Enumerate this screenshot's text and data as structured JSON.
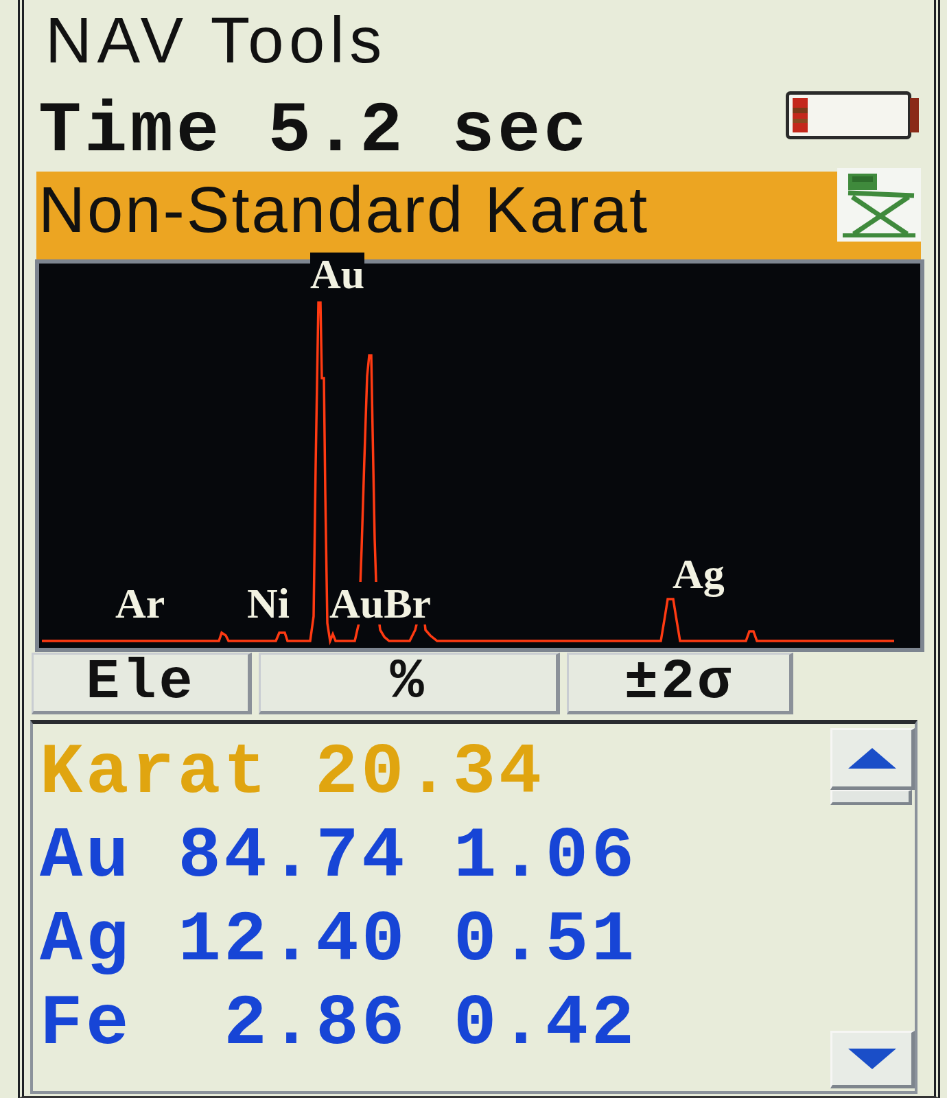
{
  "header": {
    "title": "NAV Tools",
    "time": "Time 5.2 sec"
  },
  "status_bar": {
    "text": "Non-Standard Karat"
  },
  "spectrum": {
    "peak_labels": [
      "Ar",
      "Ni",
      "Au",
      "AuBr",
      "Ag"
    ]
  },
  "columns": [
    "Ele",
    "%",
    "±2σ"
  ],
  "results": [
    {
      "kind": "karat",
      "cells": [
        "Karat",
        "20.34"
      ]
    },
    {
      "kind": "element",
      "cells": [
        "Au",
        "84.74",
        "1.06"
      ]
    },
    {
      "kind": "element",
      "cells": [
        "Ag",
        "12.40",
        "0.51"
      ]
    },
    {
      "kind": "element",
      "cells": [
        "Fe",
        "2.86",
        "0.42"
      ]
    }
  ]
}
